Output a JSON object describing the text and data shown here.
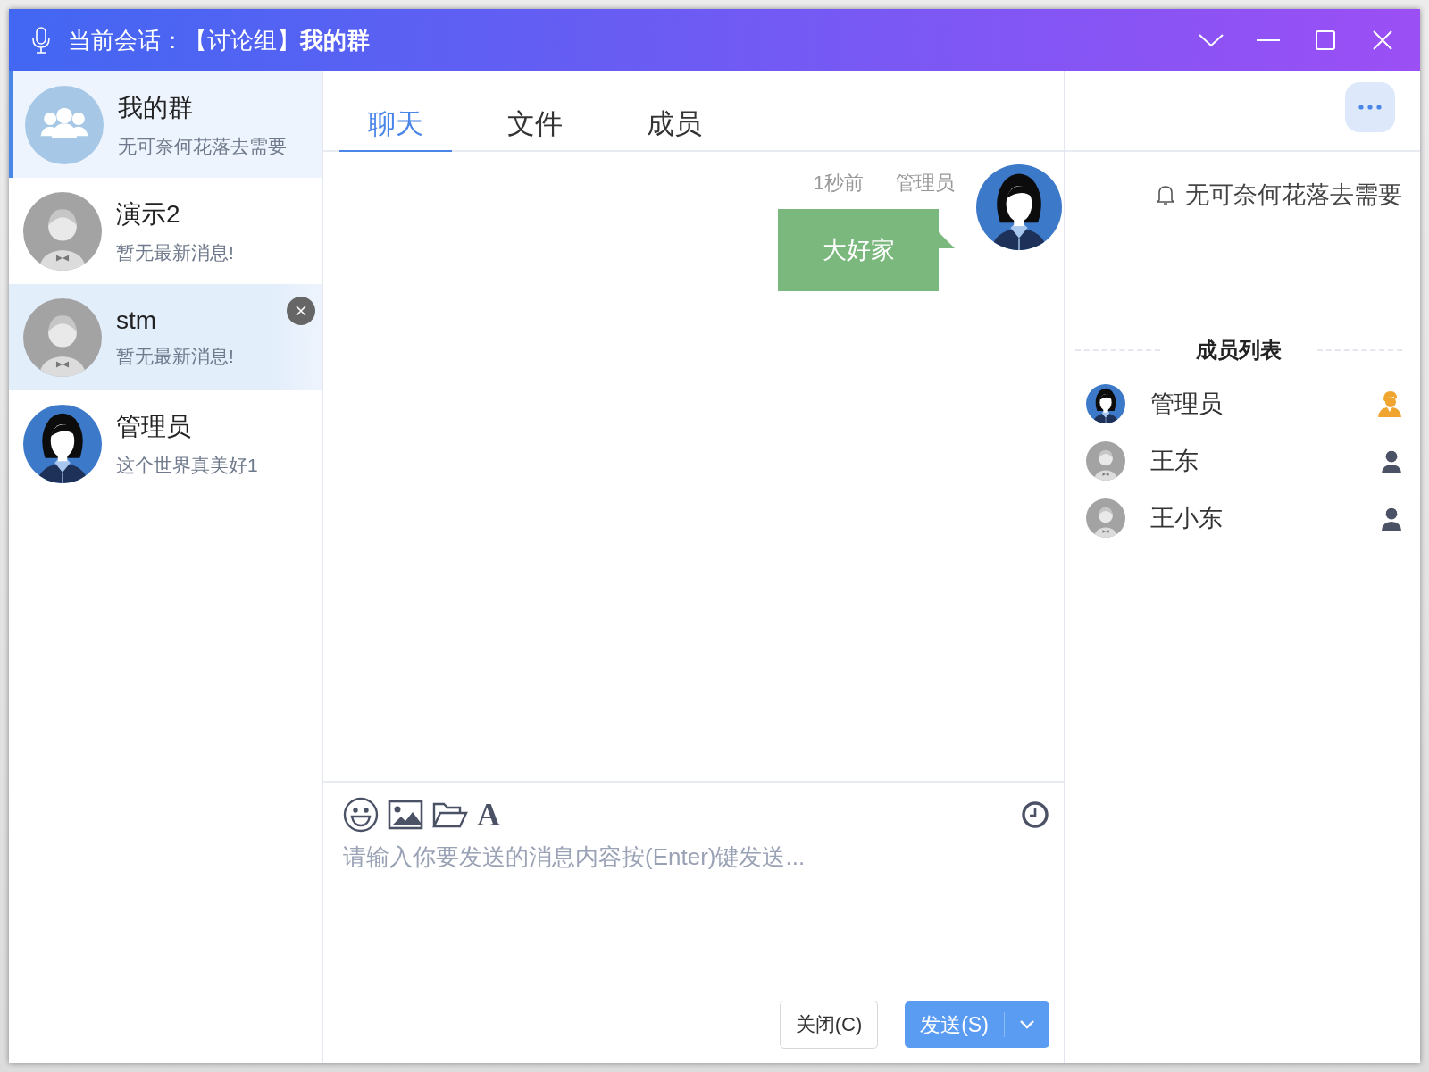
{
  "window": {
    "title": "当前会话：【讨论组】**我的群**"
  },
  "sessions": [
    {
      "name": "我的群",
      "preview": "无可奈何花落去需要",
      "kind": "group",
      "selected": true,
      "show_close": false
    },
    {
      "name": "演示2",
      "preview": "暂无最新消息!",
      "kind": "default",
      "selected": false,
      "show_close": false
    },
    {
      "name": "stm",
      "preview": "暂无最新消息!",
      "kind": "default",
      "selected": false,
      "show_close": true
    },
    {
      "name": "管理员",
      "preview": "这个世界真美好1",
      "kind": "admin",
      "selected": false,
      "show_close": false
    }
  ],
  "tabs": [
    {
      "label": "聊天",
      "selected": true
    },
    {
      "label": "文件",
      "selected": false
    },
    {
      "label": "成员",
      "selected": false
    }
  ],
  "messages": [
    {
      "time": "1秒前",
      "sender": "管理员",
      "text": "大好家",
      "kind": "admin",
      "outgoing": true
    }
  ],
  "composer": {
    "font_icon": "A",
    "placeholder": "请输入你要发送的消息内容按(Enter)键发送...",
    "close_button": "关闭(C)",
    "send_button": "发送(S)"
  },
  "notice": {
    "text": "无可奈何花落去需要"
  },
  "members": {
    "title": "成员列表",
    "items": [
      {
        "name": "管理员",
        "kind": "admin",
        "owner": true
      },
      {
        "name": "王东",
        "kind": "default",
        "owner": false
      },
      {
        "name": "王小东",
        "kind": "default",
        "owner": false
      }
    ]
  }
}
